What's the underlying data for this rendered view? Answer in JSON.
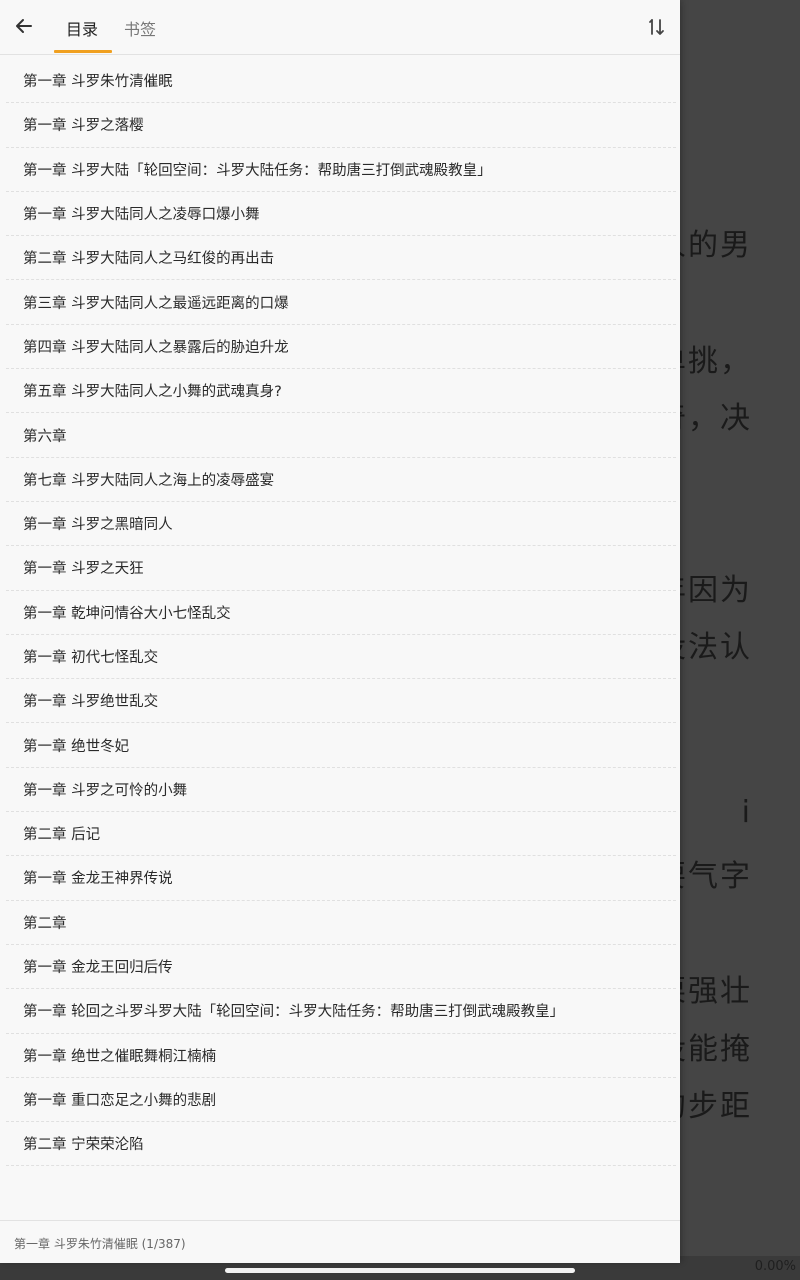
{
  "reader": {
    "lines": [
      {
        "text": "人的男"
      },
      {
        "text": "单挑，"
      },
      {
        "text": "奇，决"
      },
      {
        "text": "年因为"
      },
      {
        "text": "没法认"
      },
      {
        "text": "i"
      },
      {
        "text": "要气字"
      },
      {
        "text": "栗强壮"
      },
      {
        "text": "没能掩"
      },
      {
        "text": "的步距"
      }
    ],
    "progress": "0.00%"
  },
  "header": {
    "tab_toc": "目录",
    "tab_bookmarks": "书签",
    "sort_label": "1↓"
  },
  "chapters": [
    {
      "title": "第一章 斗罗朱竹清催眠"
    },
    {
      "title": "第一章 斗罗之落樱"
    },
    {
      "title": "第一章 斗罗大陆「轮回空间：斗罗大陆任务：帮助唐三打倒武魂殿教皇」"
    },
    {
      "title": "第一章 斗罗大陆同人之凌辱口爆小舞"
    },
    {
      "title": "第二章 斗罗大陆同人之马红俊的再出击"
    },
    {
      "title": "第三章 斗罗大陆同人之最遥远距离的口爆"
    },
    {
      "title": "第四章 斗罗大陆同人之暴露后的胁迫升龙"
    },
    {
      "title": "第五章 斗罗大陆同人之小舞的武魂真身?"
    },
    {
      "title": "第六章"
    },
    {
      "title": "第七章 斗罗大陆同人之海上的凌辱盛宴"
    },
    {
      "title": "第一章 斗罗之黑暗同人"
    },
    {
      "title": "第一章 斗罗之天狂"
    },
    {
      "title": "第一章 乾坤问情谷大小七怪乱交"
    },
    {
      "title": "第一章 初代七怪乱交"
    },
    {
      "title": "第一章 斗罗绝世乱交"
    },
    {
      "title": "第一章 绝世冬妃"
    },
    {
      "title": "第一章 斗罗之可怜的小舞"
    },
    {
      "title": "第二章 后记"
    },
    {
      "title": "第一章 金龙王神界传说"
    },
    {
      "title": "第二章"
    },
    {
      "title": "第一章 金龙王回归后传"
    },
    {
      "title": "第一章 轮回之斗罗斗罗大陆「轮回空间：斗罗大陆任务：帮助唐三打倒武魂殿教皇」"
    },
    {
      "title": "第一章 绝世之催眠舞桐江楠楠"
    },
    {
      "title": "第一章 重口恋足之小舞的悲剧"
    },
    {
      "title": "第二章 宁荣荣沦陷"
    }
  ],
  "footer": {
    "current_chapter": "第一章 斗罗朱竹清催眠 (1/387)"
  },
  "colors": {
    "accent": "#f0a020",
    "drawer_bg": "#f8f8f8",
    "overlay": "#454545"
  }
}
